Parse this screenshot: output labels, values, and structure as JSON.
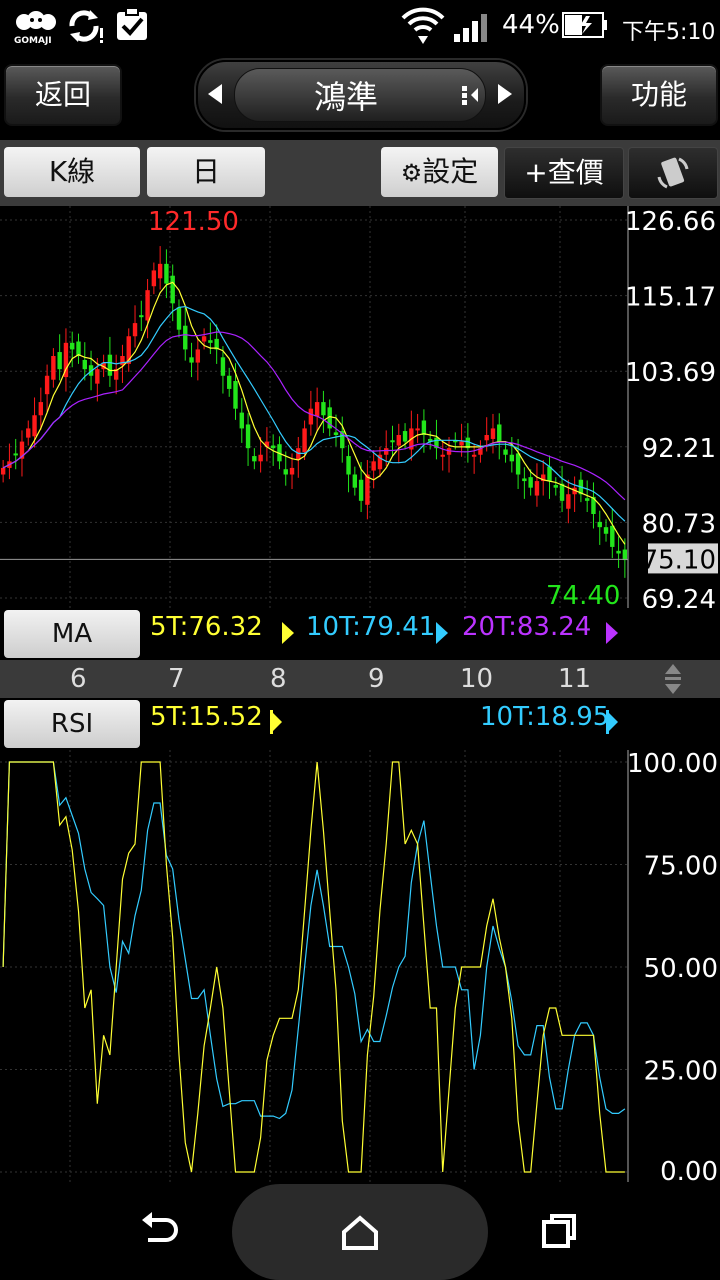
{
  "status": {
    "brand": "GOMAJI",
    "battery": "44%",
    "time": "下午5:10"
  },
  "header": {
    "back_label": "返回",
    "title": "鴻準",
    "func_label": "功能"
  },
  "toolbar": {
    "kline_label": "K線",
    "period_label": "日",
    "settings_label": "設定",
    "quote_label": "+查價"
  },
  "price_chart": {
    "high_marker": "121.50",
    "low_marker": "74.40",
    "current_price": "75.10",
    "y_labels": [
      "126.66",
      "115.17",
      "103.69",
      "92.21",
      "80.73",
      "69.24"
    ],
    "y_max": 126.66,
    "y_min": 69.24,
    "colors": {
      "up": "#ff1a1a",
      "down": "#22e51b",
      "ma5": "#ffff33",
      "ma10": "#33ccff",
      "ma20": "#aa22ff"
    }
  },
  "ma_row": {
    "label": "MA",
    "ma5": "5T:76.32",
    "ma10": "10T:79.41",
    "ma20": "20T:83.24"
  },
  "months": [
    "6",
    "7",
    "8",
    "9",
    "10",
    "11"
  ],
  "rsi_row": {
    "label": "RSI",
    "rsi5": "5T:15.52",
    "rsi10": "10T:18.95"
  },
  "rsi_chart": {
    "y_labels": [
      "100.00",
      "75.00",
      "50.00",
      "25.00",
      "0.00"
    ],
    "y_max": 100,
    "y_min": 0
  },
  "chart_data": [
    {
      "type": "candlestick",
      "ylim": [
        69.24,
        126.66
      ],
      "high": 121.5,
      "low": 74.4,
      "close": 75.1,
      "tick_labels_x": [
        "6",
        "7",
        "8",
        "9",
        "10",
        "11"
      ],
      "tick_labels_y": [
        "126.66",
        "115.17",
        "103.69",
        "92.21",
        "80.73",
        "69.24"
      ],
      "series": [
        {
          "name": "5T",
          "last": 76.32
        },
        {
          "name": "10T",
          "last": 79.41
        },
        {
          "name": "20T",
          "last": 83.24
        }
      ],
      "close_series": [
        89,
        90,
        91,
        93,
        95,
        97,
        99,
        103,
        106,
        104,
        108,
        107,
        106,
        104,
        103,
        104,
        105,
        103,
        104,
        106,
        109,
        111,
        112,
        116,
        119,
        120,
        117,
        114,
        110,
        107,
        105,
        107,
        109,
        108,
        107,
        103,
        101,
        98,
        95,
        92,
        90,
        91,
        93,
        92,
        90,
        88,
        89,
        92,
        95,
        98,
        99,
        97,
        95,
        94,
        92,
        88,
        86,
        84,
        88,
        90,
        91,
        92,
        93,
        94,
        93,
        95,
        95,
        94,
        93,
        92,
        91,
        92,
        93,
        93,
        92,
        91,
        92,
        94,
        95,
        93,
        91,
        90,
        88,
        87,
        86,
        87,
        88,
        87,
        86,
        84,
        85,
        86,
        85,
        84,
        82,
        80,
        79,
        77,
        76,
        75
      ]
    },
    {
      "type": "line",
      "ylim": [
        0,
        100
      ],
      "tick_labels_y": [
        "100.00",
        "75.00",
        "50.00",
        "25.00",
        "0.00"
      ],
      "series": [
        {
          "name": "5T",
          "last": 15.52
        },
        {
          "name": "10T",
          "last": 18.95
        }
      ]
    }
  ]
}
